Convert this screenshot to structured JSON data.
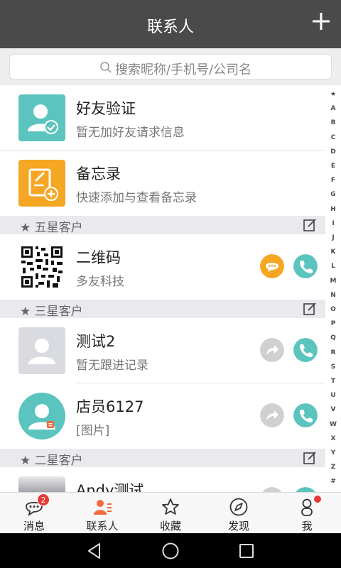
{
  "header": {
    "title": "联系人"
  },
  "search": {
    "placeholder": "搜索昵称/手机号/公司名"
  },
  "items": {
    "friend_verify": {
      "name": "好友验证",
      "sub": "暂无加好友请求信息"
    },
    "memo": {
      "name": "备忘录",
      "sub": "快速添加与查看备忘录"
    }
  },
  "sections": [
    {
      "title": "★ 五星客户",
      "contacts": [
        {
          "name": "二维码",
          "sub": "多友科技"
        }
      ]
    },
    {
      "title": "★ 三星客户",
      "contacts": [
        {
          "name": "测试2",
          "sub": "暂无跟进记录"
        },
        {
          "name": "店员6127",
          "sub": "[图片]"
        }
      ]
    },
    {
      "title": "★ 二星客户",
      "contacts": [
        {
          "name": "Andy测试",
          "sub": ""
        }
      ]
    }
  ],
  "index_letters": [
    "★",
    "A",
    "B",
    "C",
    "D",
    "E",
    "F",
    "G",
    "H",
    "I",
    "J",
    "K",
    "L",
    "M",
    "N",
    "O",
    "P",
    "Q",
    "R",
    "S",
    "T",
    "U",
    "V",
    "W",
    "X",
    "Y",
    "Z",
    "#"
  ],
  "tabs": [
    {
      "label": "消息",
      "badge": "2"
    },
    {
      "label": "联系人"
    },
    {
      "label": "收藏"
    },
    {
      "label": "发现"
    },
    {
      "label": "我"
    }
  ],
  "colors": {
    "header": "#4a4a4a",
    "teal": "#5bc4be",
    "orange": "#f5a623",
    "accent": "#f06a3a",
    "badge": "#e53935"
  }
}
